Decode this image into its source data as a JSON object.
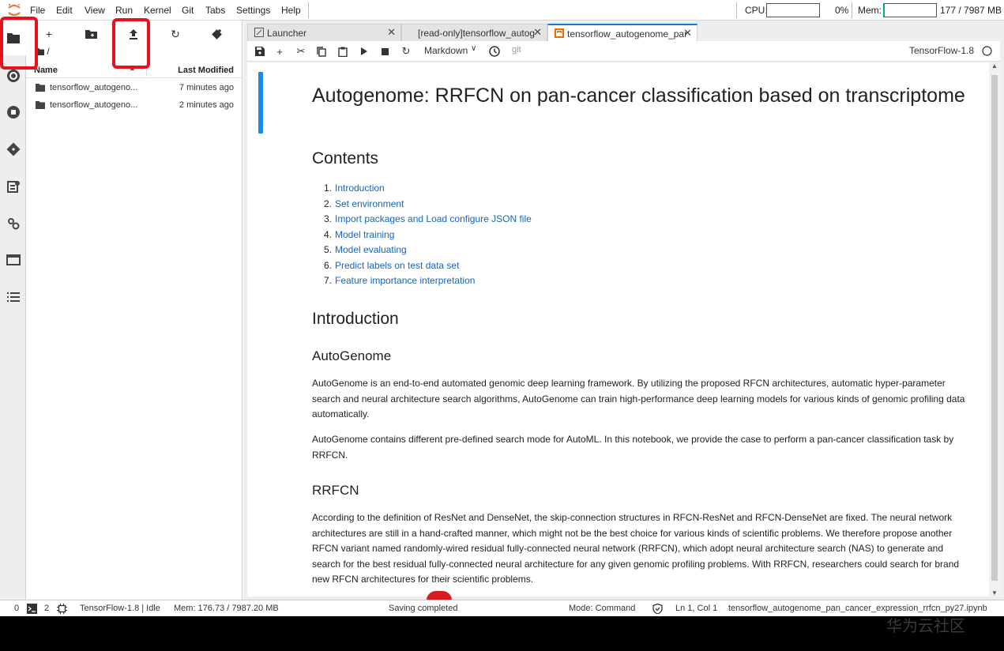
{
  "menubar": {
    "items": [
      "File",
      "Edit",
      "View",
      "Run",
      "Kernel",
      "Git",
      "Tabs",
      "Settings",
      "Help"
    ],
    "cpu_label": "CPU:",
    "cpu_value": "0%",
    "mem_label": "Mem:",
    "mem_value": "177 / 7987 MB"
  },
  "filebrowser": {
    "breadcrumb": "/",
    "col_name": "Name",
    "col_modified": "Last Modified",
    "rows": [
      {
        "name": "tensorflow_autogeno...",
        "modified": "7 minutes ago"
      },
      {
        "name": "tensorflow_autogeno...",
        "modified": "2 minutes ago"
      }
    ]
  },
  "tabs": [
    {
      "label": "Launcher"
    },
    {
      "label": "[read-only]tensorflow_autog"
    },
    {
      "label": "tensorflow_autogenome_par"
    }
  ],
  "nb_toolbar": {
    "cell_type": "Markdown",
    "git_label": "git",
    "kernel_name": "TensorFlow-1.8"
  },
  "notebook": {
    "title": "Autogenome: RRFCN on pan-cancer classification based on transcriptome",
    "contents_heading": "Contents",
    "toc": [
      "Introduction",
      "Set environment",
      "Import packages and Load configure JSON file",
      "Model training",
      "Model evaluating",
      "Predict labels on test data set",
      "Feature importance interpretation"
    ],
    "intro_heading": "Introduction",
    "autogenome_heading": "AutoGenome",
    "autogenome_p1": "AutoGenome is an end-to-end automated genomic deep learning framework. By utilizing the proposed RFCN architectures, automatic hyper-parameter search and neural architecture search algorithms, AutoGenome can train high-performance deep learning models for various kinds of genomic profiling data automatically.",
    "autogenome_p2": "AutoGenome contains different pre-defined search mode for AutoML. In this notebook, we provide the case to perform a pan-cancer classification task by RRFCN.",
    "rrfcn_heading": "RRFCN",
    "rrfcn_p1": "According to the definition of ResNet and DenseNet, the skip-connection structures in RFCN-ResNet and RFCN-DenseNet are fixed. The neural network architectures are still in a hand-crafted manner, which might not be the best choice for various kinds of scientific problems. We therefore propose another RFCN variant named randomly-wired residual fully-connected neural network (RRFCN), which adopt neural architecture search (NAS) to generate and search for the best residual fully-connected neural architecture for any given genomic profiling problems. With RRFCN, researchers could search for brand new RFCN architectures for their scientific problems."
  },
  "statusbar": {
    "zero": "0",
    "terminals": "2",
    "kernel_status": "TensorFlow-1.8 | Idle",
    "mem": "Mem: 176.73 / 7987.20 MB",
    "saving": "Saving completed",
    "mode": "Mode: Command",
    "position": "Ln 1, Col 1",
    "filename": "tensorflow_autogenome_pan_cancer_expression_rrfcn_py27.ipynb"
  },
  "watermark": "华为云社区",
  "colors": {
    "accent": "#1976d2",
    "highlight": "#e8101a",
    "link": "#1565c0"
  }
}
